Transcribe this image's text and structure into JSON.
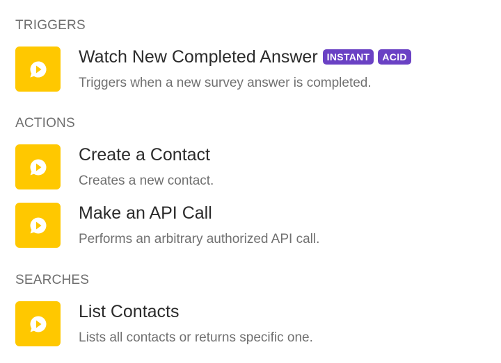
{
  "colors": {
    "icon_bg": "#ffc800",
    "badge_instant": "#6a41c4",
    "badge_acid": "#6a41c4",
    "heading": "#6f6f6f",
    "description": "#707070"
  },
  "sections": {
    "triggers": {
      "heading": "TRIGGERS",
      "items": [
        {
          "icon": "survey-app-icon",
          "title": "Watch New Completed Answer",
          "badges": [
            "INSTANT",
            "ACID"
          ],
          "description": "Triggers when a new survey answer is completed."
        }
      ]
    },
    "actions": {
      "heading": "ACTIONS",
      "items": [
        {
          "icon": "survey-app-icon",
          "title": "Create a Contact",
          "description": "Creates a new contact."
        },
        {
          "icon": "survey-app-icon",
          "title": "Make an API Call",
          "description": "Performs an arbitrary authorized API call."
        }
      ]
    },
    "searches": {
      "heading": "SEARCHES",
      "items": [
        {
          "icon": "survey-app-icon",
          "title": "List Contacts",
          "description": "Lists all contacts or returns specific one."
        }
      ]
    }
  }
}
